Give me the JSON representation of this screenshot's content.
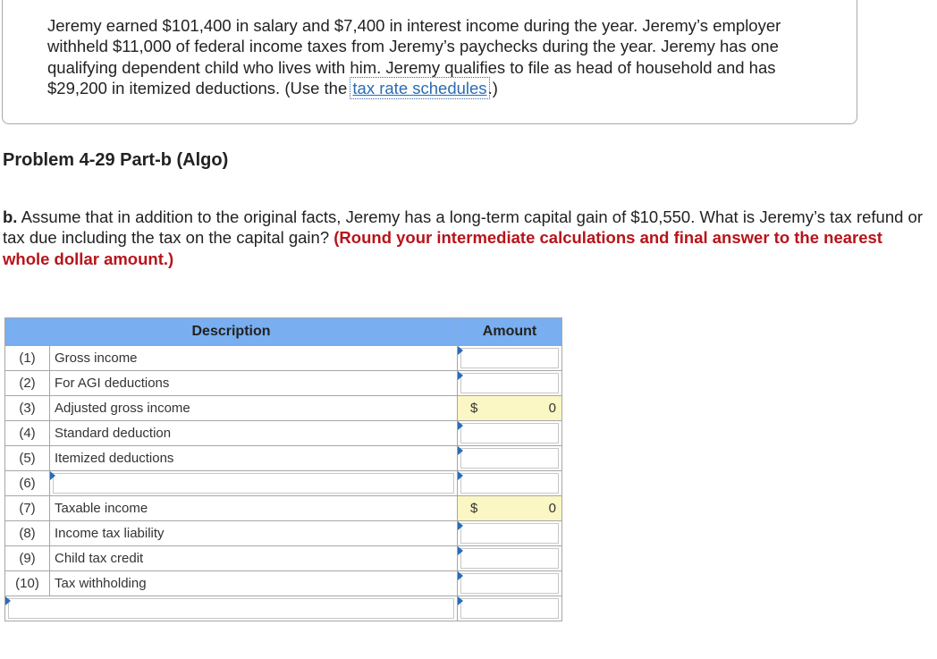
{
  "facts": {
    "text_part1": "Jeremy earned $101,400 in salary and $7,400 in interest income during the year. Jeremy’s employer withheld $11,000 of federal income taxes from Jeremy’s paychecks during the year. Jeremy has one qualifying dependent child who lives with him. Jeremy qualifies to file as head of household and has $29,200 in itemized deductions. (Use the ",
    "link_text": "tax rate schedules",
    "text_part2": ".)"
  },
  "problem": {
    "title": "Problem 4-29 Part-b (Algo)",
    "question_label": "b.",
    "question_text": " Assume that in addition to the original facts, Jeremy has a long-term capital gain of $10,550. What is Jeremy’s tax refund or tax due including the tax on the capital gain? ",
    "instruction": "(Round your intermediate calculations and final answer to the nearest whole dollar amount.)"
  },
  "table": {
    "headers": {
      "description": "Description",
      "amount": "Amount"
    },
    "rows": [
      {
        "num": "(1)",
        "label": "Gross income",
        "amount": "",
        "computed": false
      },
      {
        "num": "(2)",
        "label": "For AGI deductions",
        "amount": "",
        "computed": false
      },
      {
        "num": "(3)",
        "label": "Adjusted gross income",
        "amount": "0",
        "currency": "$",
        "computed": true
      },
      {
        "num": "(4)",
        "label": "Standard deduction",
        "amount": "",
        "computed": false
      },
      {
        "num": "(5)",
        "label": "Itemized deductions",
        "amount": "",
        "computed": false
      },
      {
        "num": "(6)",
        "label": "",
        "amount": "",
        "computed": false,
        "label_input": true
      },
      {
        "num": "(7)",
        "label": "Taxable income",
        "amount": "0",
        "currency": "$",
        "computed": true
      },
      {
        "num": "(8)",
        "label": "Income tax liability",
        "amount": "",
        "computed": false
      },
      {
        "num": "(9)",
        "label": "Child tax credit",
        "amount": "",
        "computed": false
      },
      {
        "num": "(10)",
        "label": "Tax withholding",
        "amount": "",
        "computed": false
      }
    ]
  },
  "colors": {
    "header_bg": "#79aef0",
    "computed_bg": "#faf7c4",
    "link": "#2a6bb3",
    "instruction": "#b7141b"
  }
}
